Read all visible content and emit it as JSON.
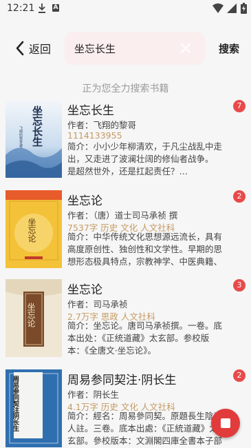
{
  "status_bar": {
    "time": "12:21",
    "badge_letter": "A"
  },
  "header": {
    "back_label": "返回",
    "search_value": "坐忘长生",
    "search_button": "搜索"
  },
  "searching_hint": "正为您全力搜索书籍",
  "books": [
    {
      "title": "坐忘长生",
      "author": "作者：飞翔的黎哥",
      "meta": "1114133955",
      "intro": "简介：小小少年柳清欢，于凡尘战乱中走出，又走进了波澜壮阔的修仙者战争。　　是超然世外，还是扛起责任？…",
      "count": "7",
      "cover_title": "坐忘长生",
      "cover_author": "飞翔的黎哥/著"
    },
    {
      "title": "坐忘论",
      "author": "作者：（唐）道士司马承祯 撰",
      "meta": "7537字 历史 文化 人文社科",
      "intro": "简介：中华传统文化思想源远流长，具有高度原创性、独创性和文学性。早期的思想形态极具特点，宗教神学、中医典籍、古代…",
      "count": "2",
      "cover_title": "坐忘论"
    },
    {
      "title": "坐忘论",
      "author": "作者：司马承祯",
      "meta": "2.7万字 思政 人文社科",
      "intro": "简介：坐忘论。唐司马承祯撰。一卷。底本出处：《正统道藏》太玄部。参校版本：《全唐文·坐忘论》。",
      "count": "3",
      "cover_title": "坐忘论"
    },
    {
      "title": "周易参同契注·阴长生",
      "author": "作者：阴长生",
      "meta": "4.1万字 历史 文化 人文社科",
      "intro": "简介：經名：周易參同契。原題長生陰真人註。三卷。底本出處：《正統道藏》太玄部。參校版本：文淵閣四庫全書本子部道…",
      "count": "2",
      "cover_title": "周易参同契注阴长生"
    }
  ],
  "colors": {
    "accent": "#e84a4a",
    "meta": "#c59a62",
    "search_bg": "#fbeeee"
  },
  "icons": [
    "download-icon",
    "wifi-icon",
    "signal-icon",
    "battery-icon",
    "back-chevron-icon",
    "clear-icon",
    "stop-icon"
  ]
}
